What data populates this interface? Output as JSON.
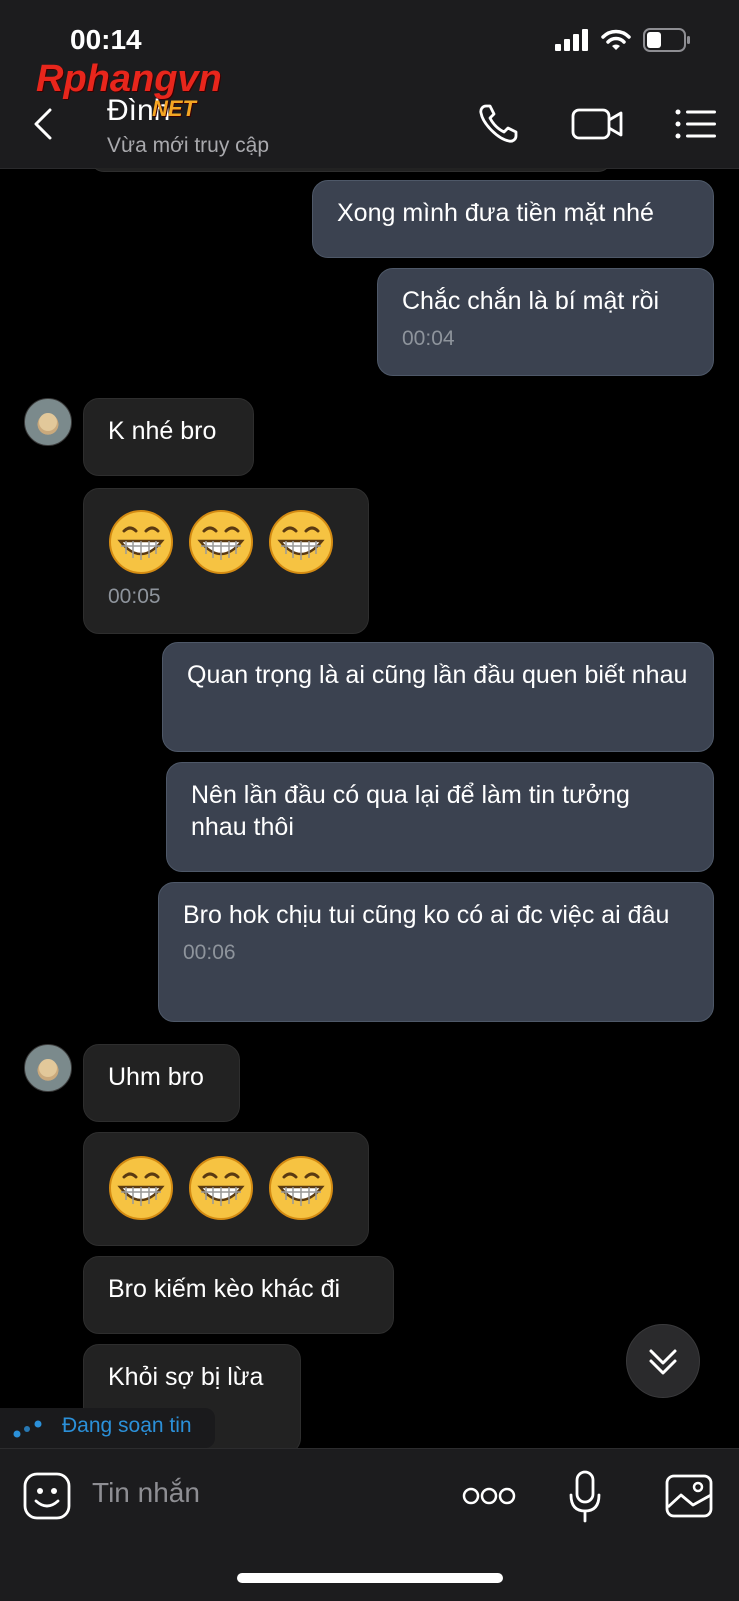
{
  "status_bar": {
    "time": "00:14"
  },
  "watermark": {
    "brand": "Rphangvn",
    "suffix": "NET"
  },
  "header": {
    "contact_name": "Đình",
    "status": "Vừa mới truy cập"
  },
  "messages": [
    {
      "dir": "out",
      "text": "Xong mình đưa tiền mặt nhé",
      "time": ""
    },
    {
      "dir": "out",
      "text": "Chắc chắn là bí mật rồi",
      "time": "00:04"
    },
    {
      "dir": "in",
      "text": "K nhé bro",
      "time": ""
    },
    {
      "dir": "in",
      "type": "emoji",
      "emoji": [
        "grin-emoji",
        "grin-emoji",
        "grin-emoji"
      ],
      "time": "00:05"
    },
    {
      "dir": "out",
      "text": "Quan trọng là ai cũng lần đầu quen biết nhau",
      "time": ""
    },
    {
      "dir": "out",
      "text": "Nên lần đầu có qua lại để làm tin tưởng nhau thôi",
      "time": ""
    },
    {
      "dir": "out",
      "text": "Bro hok chịu tui cũng ko có ai đc việc ai đâu",
      "time": "00:06"
    },
    {
      "dir": "in",
      "text": "Uhm bro",
      "time": ""
    },
    {
      "dir": "in",
      "type": "emoji",
      "emoji": [
        "grin-emoji",
        "grin-emoji",
        "grin-emoji"
      ],
      "time": ""
    },
    {
      "dir": "in",
      "text": "Bro kiếm kèo khác đi",
      "time": ""
    },
    {
      "dir": "in",
      "text": "Khỏi sợ bị lừa",
      "time": ""
    }
  ],
  "typing_indicator": "Đang soạn tin",
  "composer": {
    "placeholder": "Tin nhắn"
  },
  "colors": {
    "outgoing_bubble": "#3b4250",
    "incoming_bubble": "#222222",
    "accent": "#2b90d9"
  }
}
